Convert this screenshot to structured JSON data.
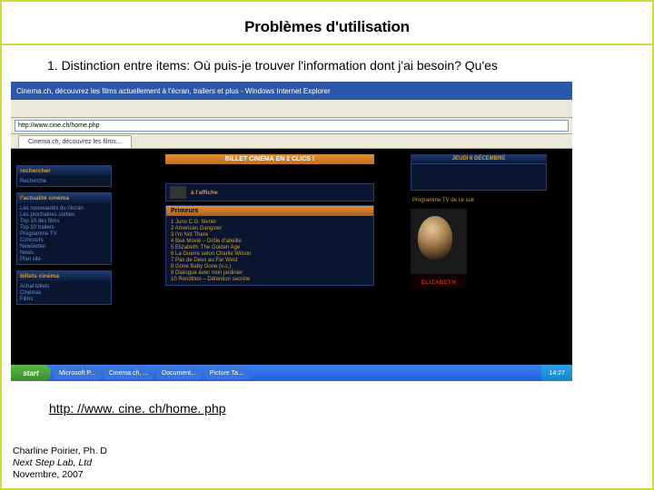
{
  "slide": {
    "title": "Problèmes d'utilisation",
    "bullet": "1.  Distinction entre items:  Où puis-je trouver l'information dont j'ai besoin?  Qu'es",
    "link": "http: //www. cine. ch/home. php"
  },
  "footer": {
    "author": "Charline Poirier, Ph. D",
    "lab": "Next Step Lab, Ltd",
    "date": "Novembre, 2007"
  },
  "screenshot": {
    "window_title": "Cinema.ch, découvrez les films actuellement à l'écran, trailers et plus - Windows Internet Explorer",
    "address": "http://www.cine.ch/home.php",
    "tab": "Cinema.ch, découvrez les films...",
    "banner": "BILLET CINÉMA EN 2 CLICS !",
    "billboard_label": "à l'affiche",
    "sidebar": {
      "box1_hd": "rechercher",
      "box1_items": [
        "Recherche"
      ],
      "box2_hd": "l'actualité cinéma",
      "box2_items": [
        "Les nouveautés du l'écran",
        "Les prochaines sorties",
        "Top 10 des films",
        "Top 10 trailers",
        "Programme TV",
        "Concours",
        "Newsletter",
        "News",
        "Plan site"
      ],
      "box3_hd": "billets cinéma",
      "box3_items": [
        "Achat billets",
        "Cinémas",
        "Films"
      ]
    },
    "main": {
      "block1_hd": "Primeurs",
      "block1_items": [
        "1  Juno  C.G. février",
        "2  American Gangster",
        "3  I'm Not There",
        "4  Bee Movie – Drôle d'abeille",
        "5  Elizabeth: The Golden Age",
        "6  La Guerre selon Charlie Wilson",
        "7  Pas de Deux au Far West",
        "8  Gone Baby Gone (v.o.)",
        "9  Dialogue avec mon jardinier",
        "10 Rendition – Détention secrète"
      ]
    },
    "right": {
      "date_hd": "JEUDI 6 DÉCEMBRE",
      "sub_hd": "Programme TV de ce soir",
      "poster_title": "ELIZABETH"
    },
    "taskbar": {
      "start": "start",
      "items": [
        "Microsoft P...",
        "Cinema.ch, ...",
        "Document...",
        "Picture Ta..."
      ],
      "clock": "14:27"
    }
  }
}
